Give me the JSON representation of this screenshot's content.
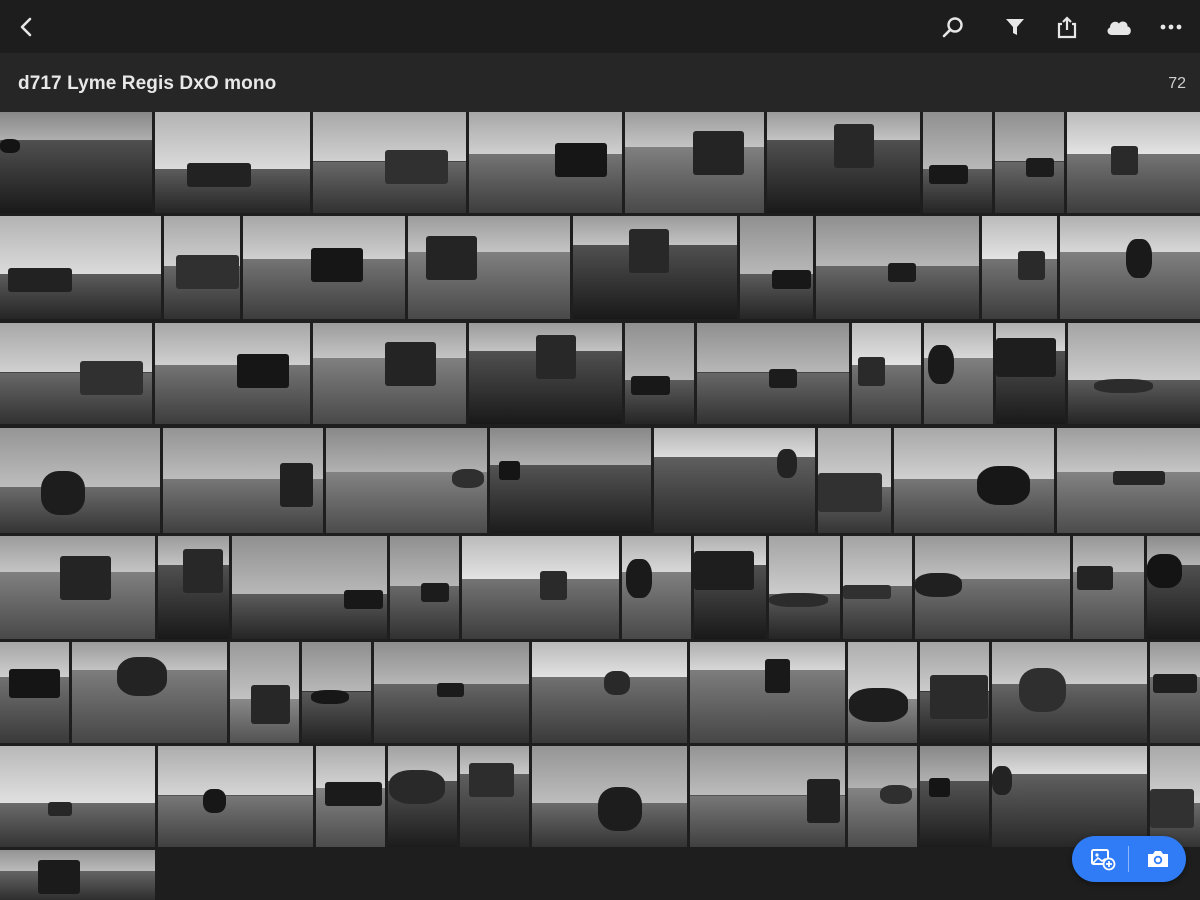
{
  "topbar": {
    "back_icon": "chevron-left-icon",
    "icons": [
      "search-icon",
      "filter-icon",
      "share-icon",
      "cloud-icon",
      "more-icon"
    ]
  },
  "album": {
    "title": "d717 Lyme Regis DxO mono",
    "count": "72"
  },
  "grid": {
    "photo_count": 72,
    "tone": "monochrome"
  },
  "fab": {
    "add_photo_icon": "add-photo-icon",
    "camera_icon": "camera-icon",
    "accent": "#2f7cf6"
  },
  "colors": {
    "topbar_bg": "#1d1d1d",
    "header_bg": "#262626",
    "grid_bg": "#1e1e1e",
    "accent": "#2f7cf6"
  }
}
